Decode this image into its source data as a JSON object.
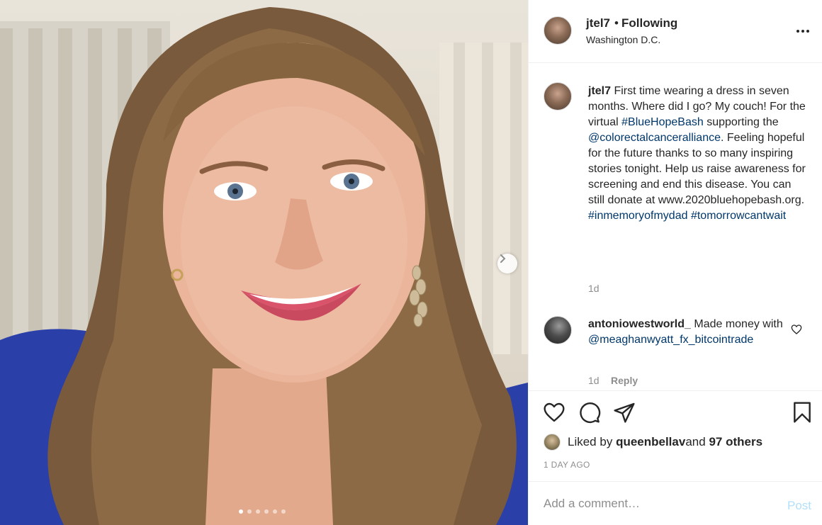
{
  "post": {
    "username": "jtel7",
    "separator": "•",
    "follow_status": "Following",
    "location": "Washington D.C.",
    "caption_prefix": "First time wearing a dress in seven months. Where did I go? My couch! For the virtual ",
    "caption_tag1": "#BlueHopeBash",
    "caption_mid1": " supporting the ",
    "caption_mention": "@colorectalcanceralliance",
    "caption_mid2": ". Feeling hopeful for the future thanks to so many inspiring stories tonight. Help us raise awareness for screening and end this disease. You can still donate at www.2020bluehopebash.org. ",
    "caption_tag2": "#inmemoryofmydad",
    "caption_tag3": "#tomorrowcantwait",
    "caption_time": "1d"
  },
  "comment": {
    "username": "antoniowestworld_",
    "text_prefix": "Made money with ",
    "mention": "@meaghanwyatt_fx_bitcointrade",
    "time": "1d",
    "reply_label": "Reply"
  },
  "likes": {
    "prefix": "Liked by ",
    "liker": "queenbellav",
    "middle": " and ",
    "others": "97 others"
  },
  "date_label": "1 DAY AGO",
  "add_comment": {
    "placeholder": "Add a comment…",
    "post_label": "Post"
  },
  "carousel": {
    "total": 6,
    "active": 1
  },
  "icons": {
    "more": "more-options-icon",
    "like": "heart-icon",
    "comment": "comment-bubble-icon",
    "share": "paper-plane-icon",
    "save": "bookmark-icon",
    "next": "chevron-right-icon"
  }
}
